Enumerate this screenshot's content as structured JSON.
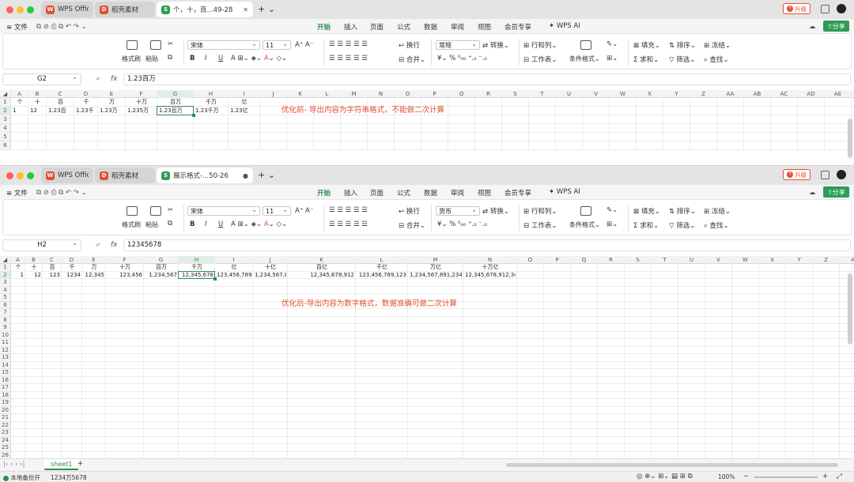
{
  "colors": {
    "accent": "#2d8c4e",
    "note": "#e24f2f",
    "close": "#fe5f57",
    "minimize": "#febc2e",
    "maximize": "#28c840"
  },
  "tabs_w1": [
    {
      "label": "WPS Office",
      "icon": "wps-logo-icon"
    },
    {
      "label": "稻壳素材",
      "icon": "docer-icon"
    },
    {
      "label": "个，十，百...49-28",
      "icon": "spreadsheet-icon"
    }
  ],
  "tabs_w2": [
    {
      "label": "WPS Office",
      "icon": "wps-logo-icon"
    },
    {
      "label": "稻壳素材",
      "icon": "docer-icon"
    },
    {
      "label": "展示格式-...50-26",
      "icon": "spreadsheet-icon"
    }
  ],
  "upgrade_label": "升级",
  "menu": {
    "file": "文件",
    "items": [
      "开始",
      "插入",
      "页面",
      "公式",
      "数据",
      "审阅",
      "视图",
      "会员专享"
    ],
    "ai": "WPS AI",
    "share": "分享"
  },
  "ribbon": {
    "format_painter": "格式刷",
    "paste": "粘贴",
    "font_name": "宋体",
    "font_size": "11",
    "wrap": "换行",
    "merge": "合并",
    "num_format_w1": "常规",
    "num_format_w2": "货币",
    "convert": "转换",
    "rows_cols": "行和列",
    "worksheet": "工作表",
    "cond_format": "条件格式",
    "fill": "填充",
    "sort": "排序",
    "freeze": "冻结",
    "sum": "求和",
    "filter": "筛选",
    "find": "查找",
    "bold": "B",
    "italic": "I",
    "underline": "U",
    "percent": "%"
  },
  "w1": {
    "name_box": "G2",
    "formula": "1.23百万",
    "columns": [
      "A",
      "B",
      "C",
      "D",
      "E",
      "F",
      "G",
      "H",
      "I",
      "J",
      "K",
      "L",
      "M",
      "N",
      "O",
      "P",
      "Q",
      "R",
      "S",
      "T",
      "U",
      "V",
      "W",
      "X",
      "Y",
      "Z",
      "AA",
      "AB",
      "AC",
      "AD",
      "AE"
    ],
    "rows": [
      "1",
      "2",
      "3",
      "4",
      "5",
      "6"
    ],
    "row1": [
      "个",
      "十",
      "百",
      "千",
      "万",
      "十万",
      "百万",
      "千万",
      "亿"
    ],
    "row2": [
      "1",
      "12",
      "1.23百",
      "1.23千",
      "1.23万",
      "1.235万",
      "1.23百万",
      "1.23千万",
      "1.23亿"
    ],
    "note": "优化前- 导出内容为字符串格式，不能做二次计算"
  },
  "w2": {
    "name_box": "H2",
    "formula": "12345678",
    "columns": [
      "A",
      "B",
      "C",
      "D",
      "E",
      "F",
      "G",
      "H",
      "I",
      "J",
      "K",
      "L",
      "M",
      "N",
      "O",
      "P",
      "Q",
      "R",
      "S",
      "T",
      "U",
      "V",
      "W",
      "X",
      "Y",
      "Z",
      "A"
    ],
    "rows": [
      "1",
      "2",
      "3",
      "4",
      "5",
      "6",
      "7",
      "8",
      "9",
      "10",
      "11",
      "12",
      "13",
      "14",
      "15",
      "16",
      "17",
      "18",
      "19",
      "20",
      "21",
      "22",
      "23",
      "24",
      "25",
      "26",
      "27"
    ],
    "row1": [
      "个",
      "十",
      "百",
      "千",
      "万",
      "十万",
      "百万",
      "千万",
      "亿",
      "十亿",
      "百亿",
      "千亿",
      "万亿",
      "十万亿"
    ],
    "row2": [
      "1",
      "12",
      "123",
      "1234",
      "12,345",
      "123,456",
      "1,234,567",
      "12,345,678",
      "123,456,789",
      "1,234,567,891",
      "12,345,678,912",
      "123,456,789,123",
      "1,234,567,891,234",
      "12,345,678,912,345"
    ],
    "note": "优化后-导出内容为数字格式，数据准确可做二次计算",
    "sheet_tab": "sheet1",
    "status_left": "本地备份开",
    "status_sum": "1234万5678",
    "zoom": "100%"
  }
}
